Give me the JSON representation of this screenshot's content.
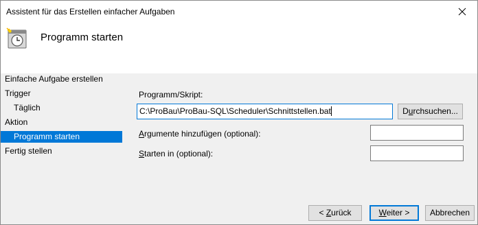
{
  "window": {
    "title": "Assistent für das Erstellen einfacher Aufgaben",
    "close_icon": "close-icon"
  },
  "header": {
    "icon": "task-clock-icon",
    "title": "Programm starten"
  },
  "sidebar": {
    "items": [
      {
        "label": "Einfache Aufgabe erstellen",
        "level": 0,
        "selected": false
      },
      {
        "label": "Trigger",
        "level": 0,
        "selected": false
      },
      {
        "label": "Täglich",
        "level": 1,
        "selected": false
      },
      {
        "label": "Aktion",
        "level": 0,
        "selected": false
      },
      {
        "label": "Programm starten",
        "level": 1,
        "selected": true
      },
      {
        "label": "Fertig stellen",
        "level": 0,
        "selected": false
      }
    ]
  },
  "form": {
    "program_label": "Programm/Skript:",
    "program_value": "C:\\ProBau\\ProBau-SQL\\Scheduler\\Schnittstellen.bat",
    "browse_button_pre": "D",
    "browse_button_mnemonic": "u",
    "browse_button_post": "rchsuchen...",
    "arguments_label_mnemonic": "A",
    "arguments_label_rest": "rgumente hinzufügen (optional):",
    "arguments_value": "",
    "start_in_label_mnemonic": "S",
    "start_in_label_rest": "tarten in (optional):",
    "start_in_value": ""
  },
  "footer": {
    "back_pre": "< ",
    "back_mnemonic": "Z",
    "back_post": "urück",
    "next_mnemonic": "W",
    "next_post": "eiter >",
    "cancel_label": "Abbrechen"
  },
  "colors": {
    "accent": "#0078d7",
    "window_bg": "#f0f0f0",
    "header_bg": "#ffffff"
  }
}
